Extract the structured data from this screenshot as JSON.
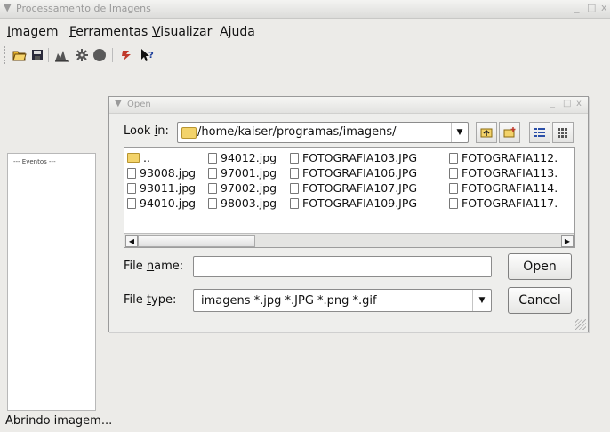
{
  "window": {
    "title": "Processamento de Imagens",
    "controls": [
      "_",
      "□",
      "x"
    ]
  },
  "menubar": {
    "items": [
      {
        "label": "Imagem",
        "mnemonic": "I",
        "rest": "magem"
      },
      {
        "label": "Ferramentas",
        "mnemonic": "F",
        "rest": "erramentas"
      },
      {
        "label": "Visualizar",
        "mnemonic": "V",
        "rest": "isualizar"
      },
      {
        "label": "Ajuda",
        "mnemonic": "",
        "rest": "Ajuda"
      }
    ]
  },
  "toolbar": {
    "icons": [
      "open-folder-icon",
      "save-icon",
      "histogram-icon",
      "gear-icon",
      "circle-icon",
      "refresh-icon",
      "whats-this-icon"
    ]
  },
  "events_panel": {
    "label": "--- Eventos ---"
  },
  "status": {
    "text": "Abrindo imagem..."
  },
  "dialog": {
    "title": "Open",
    "controls": [
      "_",
      "□",
      "x"
    ],
    "lookin_label_a": "Look ",
    "lookin_label_m": "i",
    "lookin_label_b": "n:",
    "lookin_path": "/home/kaiser/programas/imagens/",
    "files": [
      [
        "..",
        "93008.jpg",
        "93011.jpg",
        "94010.jpg"
      ],
      [
        "94012.jpg",
        "97001.jpg",
        "97002.jpg",
        "98003.jpg"
      ],
      [
        "FOTOGRAFIA103.JPG",
        "FOTOGRAFIA106.JPG",
        "FOTOGRAFIA107.JPG",
        "FOTOGRAFIA109.JPG"
      ],
      [
        "FOTOGRAFIA112.",
        "FOTOGRAFIA113.",
        "FOTOGRAFIA114.",
        "FOTOGRAFIA117."
      ]
    ],
    "filename_label_a": "File ",
    "filename_label_m": "n",
    "filename_label_b": "ame:",
    "filename_value": "",
    "filetype_label_a": "File ",
    "filetype_label_m": "t",
    "filetype_label_b": "ype:",
    "filetype_value": "imagens *.jpg *.JPG *.png *.gif",
    "open_label": "Open",
    "cancel_label": "Cancel"
  }
}
